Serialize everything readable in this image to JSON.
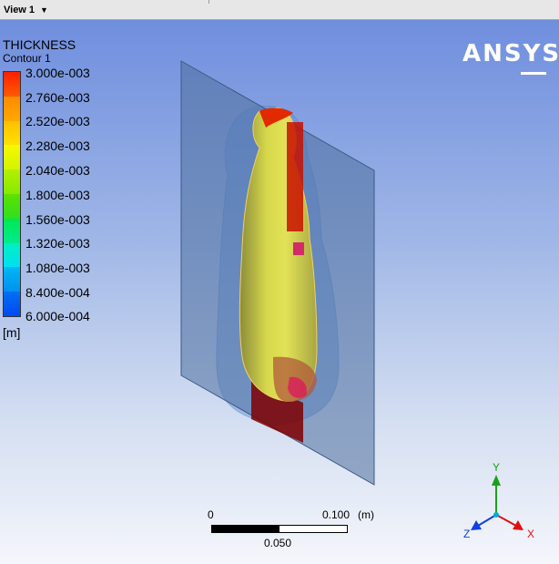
{
  "toolbar": {
    "view_label": "View 1"
  },
  "legend": {
    "title": "THICKNESS",
    "subtitle": "Contour 1",
    "unit": "[m]",
    "labels": [
      "3.000e-003",
      "2.760e-003",
      "2.520e-003",
      "2.280e-003",
      "2.040e-003",
      "1.800e-003",
      "1.560e-003",
      "1.320e-003",
      "1.080e-003",
      "8.400e-004",
      "6.000e-004"
    ],
    "colors": [
      "#ff2000",
      "#ff8a00",
      "#ffc800",
      "#f4f400",
      "#b8f000",
      "#5ee000",
      "#00e85c",
      "#00f0c8",
      "#00b4f0",
      "#0070f0",
      "#0020ff"
    ]
  },
  "logo": {
    "text": "ANSYS"
  },
  "scale": {
    "zero": "0",
    "max": "0.100",
    "unit": "(m)",
    "mid": "0.050"
  },
  "axes": {
    "x": "X",
    "y": "Y",
    "z": "Z"
  }
}
